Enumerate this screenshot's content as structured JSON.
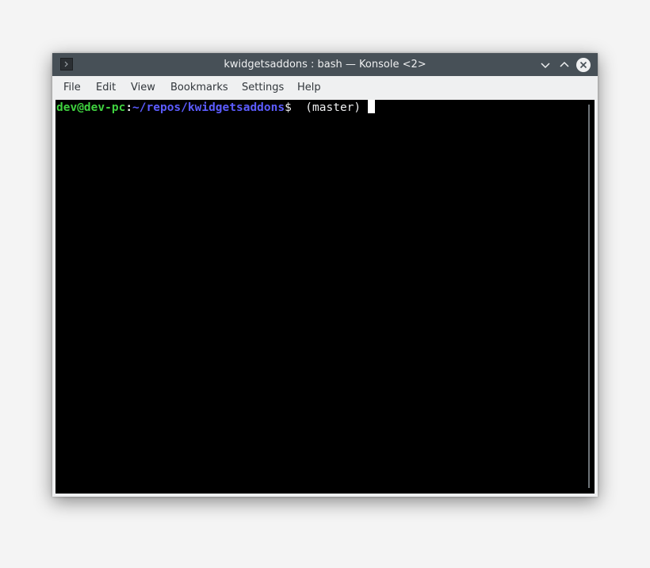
{
  "window": {
    "title": "kwidgetsaddons : bash — Konsole <2>"
  },
  "menu": {
    "items": [
      {
        "label": "File"
      },
      {
        "label": "Edit"
      },
      {
        "label": "View"
      },
      {
        "label": "Bookmarks"
      },
      {
        "label": "Settings"
      },
      {
        "label": "Help"
      }
    ]
  },
  "terminal": {
    "prompt_user_host": "dev@dev-pc",
    "prompt_colon": ":",
    "prompt_path": "~/repos/kwidgetsaddons",
    "prompt_symbol": "$",
    "git_branch": " (master) "
  },
  "icons": {
    "app": "konsole-icon",
    "minimize": "chevron-down-icon",
    "maximize": "chevron-up-icon",
    "close": "close-icon"
  },
  "colors": {
    "titlebar": "#475057",
    "terminal_bg": "#000000",
    "prompt_user": "#3fd13f",
    "prompt_path": "#5c5cff"
  }
}
